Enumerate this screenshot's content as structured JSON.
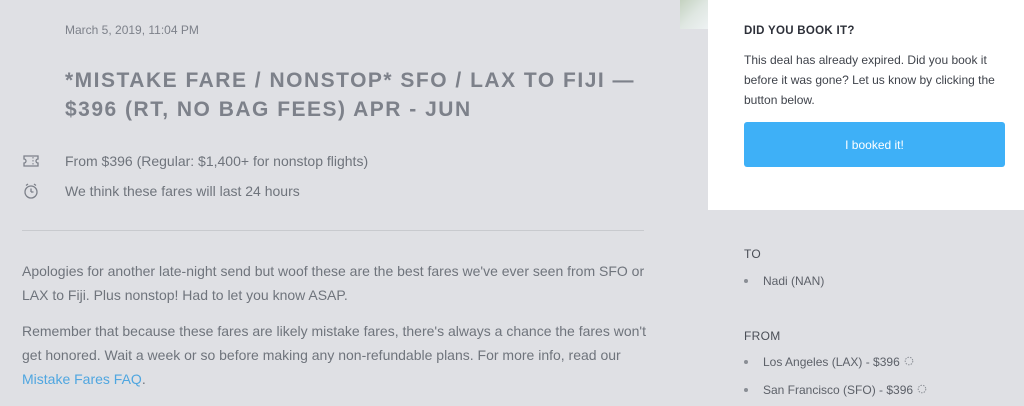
{
  "deal": {
    "date": "March 5, 2019, 11:04 PM",
    "title": "*MISTAKE FARE / NONSTOP* SFO / LAX TO FIJI — $396 (RT, NO BAG FEES) APR - JUN",
    "price_info": "From $396 (Regular: $1,400+ for nonstop flights)",
    "duration_info": "We think these fares will last 24 hours",
    "paragraph1": "Apologies for another late-night send but woof these are the best fares we've ever seen from SFO or LAX to Fiji. Plus nonstop! Had to let you know ASAP.",
    "paragraph2_text": "Remember that because these fares are likely mistake fares, there's always a chance the fares won't get honored. Wait a week or so before making any non-refundable plans. For more info, read our ",
    "paragraph2_link": "Mistake Fares FAQ",
    "paragraph2_end": "."
  },
  "booking": {
    "title": "DID YOU BOOK IT?",
    "text": "This deal has already expired. Did you book it before it was gone? Let us know by clicking the button below.",
    "button_label": "I booked it!"
  },
  "routes": {
    "to_label": "TO",
    "to": [
      "Nadi (NAN)"
    ],
    "from_label": "FROM",
    "from": [
      "Los Angeles (LAX) - $396",
      "San Francisco (SFO) - $396"
    ]
  },
  "icons": {
    "ticket": "ticket-icon",
    "clock": "clock-icon",
    "spinner": "loading-spinner-icon"
  },
  "colors": {
    "background": "#dfe0e4",
    "accent_button": "#3eb0f7",
    "link": "#4fa6e0",
    "card": "#ffffff"
  }
}
